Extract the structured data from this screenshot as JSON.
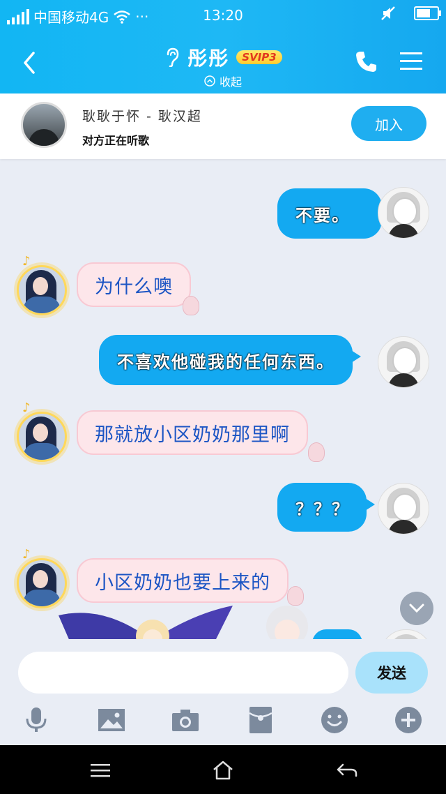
{
  "status_bar": {
    "carrier": "中国移动4G",
    "time": "13:20",
    "dots": "···"
  },
  "header": {
    "title": "彤彤",
    "badge": "SVIP3",
    "collapse_label": "收起"
  },
  "music": {
    "song": "耿耿于怀 - 耿汉超",
    "status": "对方正在听歌",
    "join_label": "加入"
  },
  "messages": [
    {
      "side": "out",
      "text": "不要。"
    },
    {
      "side": "in",
      "text": "为什么噢"
    },
    {
      "side": "out",
      "text": "不喜欢他碰我的任何东西。"
    },
    {
      "side": "in",
      "text": "那就放小区奶奶那里啊"
    },
    {
      "side": "out",
      "text": "？？？"
    },
    {
      "side": "in",
      "text": "小区奶奶也要上来的"
    }
  ],
  "composer": {
    "placeholder": "",
    "send_label": "发送"
  },
  "toolbar": [
    "microphone-icon",
    "image-icon",
    "camera-icon",
    "red-packet-icon",
    "emoji-icon",
    "plus-icon"
  ],
  "colors": {
    "header_bg": "#12b6f3",
    "bubble_out": "#13a9f1",
    "bubble_in": "#fde6ea",
    "bubble_in_text": "#1c55c4",
    "svip": "#ffcc2e"
  }
}
